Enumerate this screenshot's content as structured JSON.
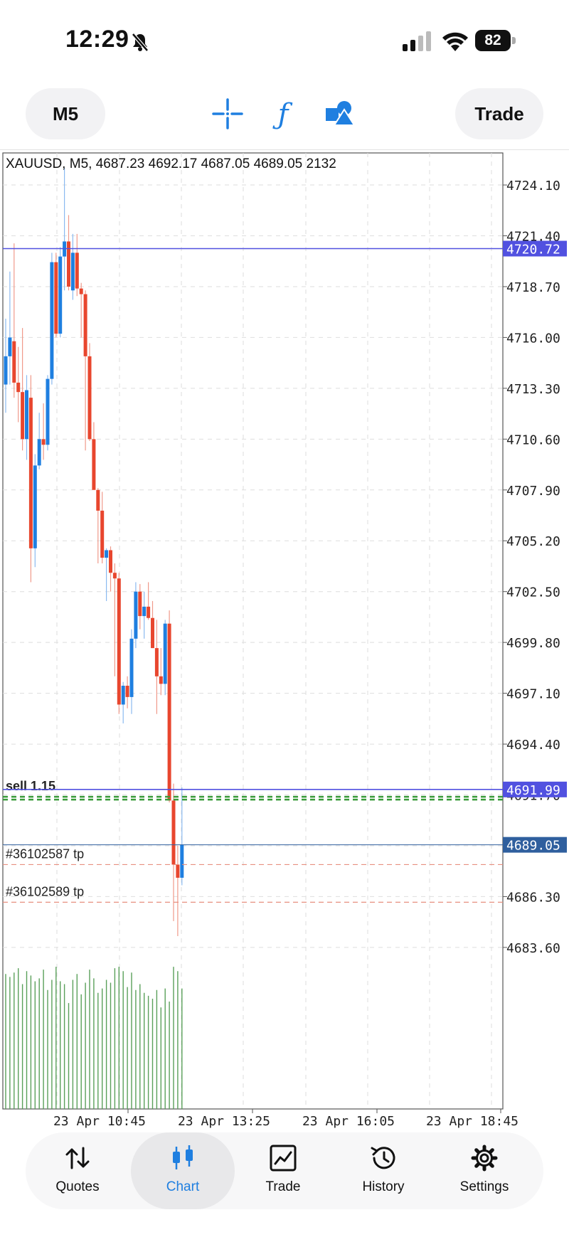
{
  "status_bar": {
    "time": "12:29",
    "battery": "82"
  },
  "toolbar": {
    "timeframe": "M5",
    "trade_label": "Trade"
  },
  "chart_data": {
    "type": "candlestick",
    "header": "XAUUSD, M5, 4687.23 4692.17 4687.05 4689.05 2132",
    "y_ticks": [
      "4724.10",
      "4721.40",
      "4718.70",
      "4716.00",
      "4713.30",
      "4710.60",
      "4707.90",
      "4705.20",
      "4702.50",
      "4699.80",
      "4697.10",
      "4694.40",
      "4691.70",
      "4689.00",
      "4686.30",
      "4683.60"
    ],
    "ylim": [
      4682.5,
      4725.5
    ],
    "x_ticks": [
      "23 Apr 10:45",
      "23 Apr 13:25",
      "23 Apr 16:05",
      "23 Apr 18:45"
    ],
    "lines": [
      {
        "price": 4720.72,
        "label": "4720.72",
        "color": "#5151e0"
      },
      {
        "price": 4691.99,
        "label": "4691.99",
        "color": "#5151e0"
      },
      {
        "price": 4689.05,
        "label": "4689.05",
        "color": "#2f5f9e"
      }
    ],
    "order_lines": [
      {
        "price": 4691.6,
        "label": "sell 1.15"
      },
      {
        "price": 4688.0,
        "label": "#36102587 tp"
      },
      {
        "price": 4686.0,
        "label": "#36102589 tp"
      }
    ],
    "candles": [
      {
        "o": 4713.5,
        "h": 4717.0,
        "l": 4712.0,
        "c": 4715.0
      },
      {
        "o": 4715.0,
        "h": 4719.5,
        "l": 4713.5,
        "c": 4716.0
      },
      {
        "o": 4715.8,
        "h": 4721.0,
        "l": 4712.8,
        "c": 4713.6
      },
      {
        "o": 4713.6,
        "h": 4715.5,
        "l": 4711.5,
        "c": 4713.1
      },
      {
        "o": 4713.1,
        "h": 4716.5,
        "l": 4710.0,
        "c": 4710.6
      },
      {
        "o": 4710.6,
        "h": 4714.0,
        "l": 4709.5,
        "c": 4713.2
      },
      {
        "o": 4712.8,
        "h": 4714.0,
        "l": 4703.0,
        "c": 4704.8
      },
      {
        "o": 4704.8,
        "h": 4709.8,
        "l": 4703.8,
        "c": 4709.2
      },
      {
        "o": 4709.2,
        "h": 4712.0,
        "l": 4709.0,
        "c": 4710.6
      },
      {
        "o": 4710.6,
        "h": 4712.5,
        "l": 4709.5,
        "c": 4710.3
      },
      {
        "o": 4710.3,
        "h": 4714.0,
        "l": 4710.0,
        "c": 4713.8
      },
      {
        "o": 4713.8,
        "h": 4720.5,
        "l": 4713.5,
        "c": 4720.0
      },
      {
        "o": 4720.0,
        "h": 4720.5,
        "l": 4716.0,
        "c": 4716.2
      },
      {
        "o": 4716.2,
        "h": 4720.8,
        "l": 4716.0,
        "c": 4720.3
      },
      {
        "o": 4720.3,
        "h": 4725.0,
        "l": 4718.5,
        "c": 4721.1
      },
      {
        "o": 4721.1,
        "h": 4722.5,
        "l": 4718.5,
        "c": 4718.7
      },
      {
        "o": 4718.5,
        "h": 4721.5,
        "l": 4718.0,
        "c": 4720.5
      },
      {
        "o": 4720.5,
        "h": 4721.5,
        "l": 4718.2,
        "c": 4718.6
      },
      {
        "o": 4718.6,
        "h": 4718.9,
        "l": 4716.0,
        "c": 4718.3
      },
      {
        "o": 4718.3,
        "h": 4718.5,
        "l": 4710.0,
        "c": 4715.0
      },
      {
        "o": 4715.0,
        "h": 4715.7,
        "l": 4710.5,
        "c": 4710.6
      },
      {
        "o": 4710.6,
        "h": 4711.5,
        "l": 4708.5,
        "c": 4707.9
      },
      {
        "o": 4707.9,
        "h": 4708.0,
        "l": 4704.0,
        "c": 4706.8
      },
      {
        "o": 4706.8,
        "h": 4707.8,
        "l": 4704.0,
        "c": 4704.3
      },
      {
        "o": 4704.3,
        "h": 4704.8,
        "l": 4702.0,
        "c": 4704.7
      },
      {
        "o": 4704.7,
        "h": 4704.9,
        "l": 4702.5,
        "c": 4703.5
      },
      {
        "o": 4703.5,
        "h": 4704.0,
        "l": 4698.0,
        "c": 4703.2
      },
      {
        "o": 4703.2,
        "h": 4703.5,
        "l": 4696.0,
        "c": 4696.5
      },
      {
        "o": 4696.5,
        "h": 4697.7,
        "l": 4695.5,
        "c": 4697.5
      },
      {
        "o": 4697.5,
        "h": 4698.0,
        "l": 4696.3,
        "c": 4696.9
      },
      {
        "o": 4696.9,
        "h": 4700.5,
        "l": 4696.0,
        "c": 4700.0
      },
      {
        "o": 4700.0,
        "h": 4703.0,
        "l": 4699.5,
        "c": 4702.5
      },
      {
        "o": 4702.5,
        "h": 4702.9,
        "l": 4700.5,
        "c": 4701.2
      },
      {
        "o": 4701.2,
        "h": 4702.5,
        "l": 4700.0,
        "c": 4701.7
      },
      {
        "o": 4701.7,
        "h": 4703.0,
        "l": 4701.0,
        "c": 4701.1
      },
      {
        "o": 4701.1,
        "h": 4702.0,
        "l": 4699.5,
        "c": 4699.5
      },
      {
        "o": 4699.5,
        "h": 4701.0,
        "l": 4696.0,
        "c": 4698.0
      },
      {
        "o": 4698.0,
        "h": 4699.5,
        "l": 4697.0,
        "c": 4697.6
      },
      {
        "o": 4697.6,
        "h": 4701.0,
        "l": 4697.0,
        "c": 4700.8
      },
      {
        "o": 4700.8,
        "h": 4701.5,
        "l": 4691.3,
        "c": 4691.4
      },
      {
        "o": 4691.4,
        "h": 4692.3,
        "l": 4685.0,
        "c": 4688.0
      },
      {
        "o": 4688.0,
        "h": 4689.0,
        "l": 4684.2,
        "c": 4687.3
      },
      {
        "o": 4687.3,
        "h": 4692.1,
        "l": 4686.9,
        "c": 4689.05
      }
    ],
    "volumes": [
      0.93,
      0.91,
      0.94,
      0.97,
      0.86,
      0.95,
      0.92,
      0.88,
      0.9,
      0.96,
      0.82,
      0.89,
      0.98,
      0.88,
      0.86,
      0.73,
      0.89,
      0.93,
      0.79,
      0.87,
      0.96,
      0.9,
      0.8,
      0.83,
      0.89,
      0.87,
      0.97,
      0.98,
      0.95,
      0.84,
      0.94,
      0.82,
      0.86,
      0.8,
      0.78,
      0.76,
      0.82,
      0.7,
      0.83,
      0.74,
      0.98,
      0.95,
      0.83
    ]
  },
  "nav": {
    "items": [
      {
        "label": "Quotes"
      },
      {
        "label": "Chart"
      },
      {
        "label": "Trade"
      },
      {
        "label": "History"
      },
      {
        "label": "Settings"
      }
    ]
  }
}
